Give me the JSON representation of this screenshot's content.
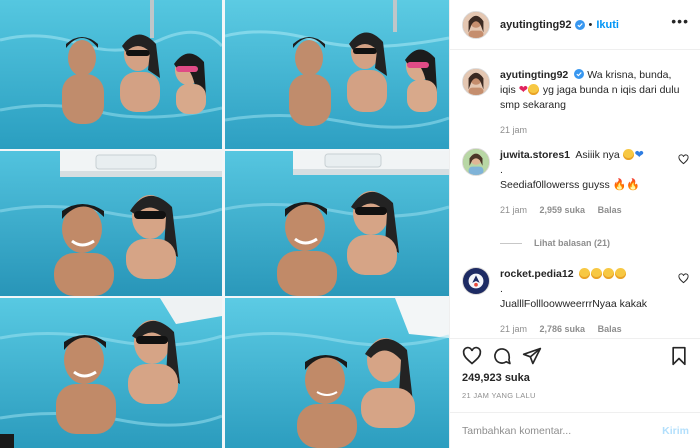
{
  "post": {
    "author": "ayutingting92",
    "follow_label": "Ikuti",
    "separator": "•",
    "more_label": "•••",
    "caption": {
      "username": "ayutingting92",
      "text_part1": "Wa krisna, bunda, iqis",
      "text_part2": "yg jaga bunda n iqis dari dulu smp sekarang",
      "emoji": [
        "red-heart",
        "heart-eyes-face"
      ],
      "age": "21 jam"
    },
    "likes": "249,923 suka",
    "timestamp": "21 JAM YANG LALU"
  },
  "comments": [
    {
      "username": "juwita.stores1",
      "line1": "Asiiik nya",
      "line1_emoji": [
        "heart-eyes-face",
        "blue-heart"
      ],
      "line2": ".",
      "line3": "Seediaf0llowerss guyss",
      "line3_emoji": [
        "fire",
        "fire"
      ],
      "age": "21 jam",
      "like_count": "2,959 suka",
      "reply_label": "Balas",
      "view_replies": "Lihat balasan (21)"
    },
    {
      "username": "rocket.pedia12",
      "line1_emoji": [
        "heart-eyes-face",
        "heart-eyes-face",
        "heart-eyes-face",
        "heart-eyes-face"
      ],
      "line2": ".",
      "line3": "JualllFollloowweerrrNyaa kakak",
      "age": "21 jam",
      "like_count": "2,786 suka",
      "reply_label": "Balas"
    }
  ],
  "comment_box": {
    "placeholder": "Tambahkan komentar...",
    "post_label": "Kirim"
  },
  "icons": {
    "like": "heart-outline-icon",
    "comment": "comment-bubble-icon",
    "share": "paper-plane-icon",
    "save": "bookmark-icon",
    "verified": "verified-badge-icon"
  },
  "colors": {
    "link_blue": "#0095f6",
    "muted_text": "#8e8e8e",
    "pool_water": "#3fb6d6",
    "post_button_disabled": "#b2dffc"
  }
}
